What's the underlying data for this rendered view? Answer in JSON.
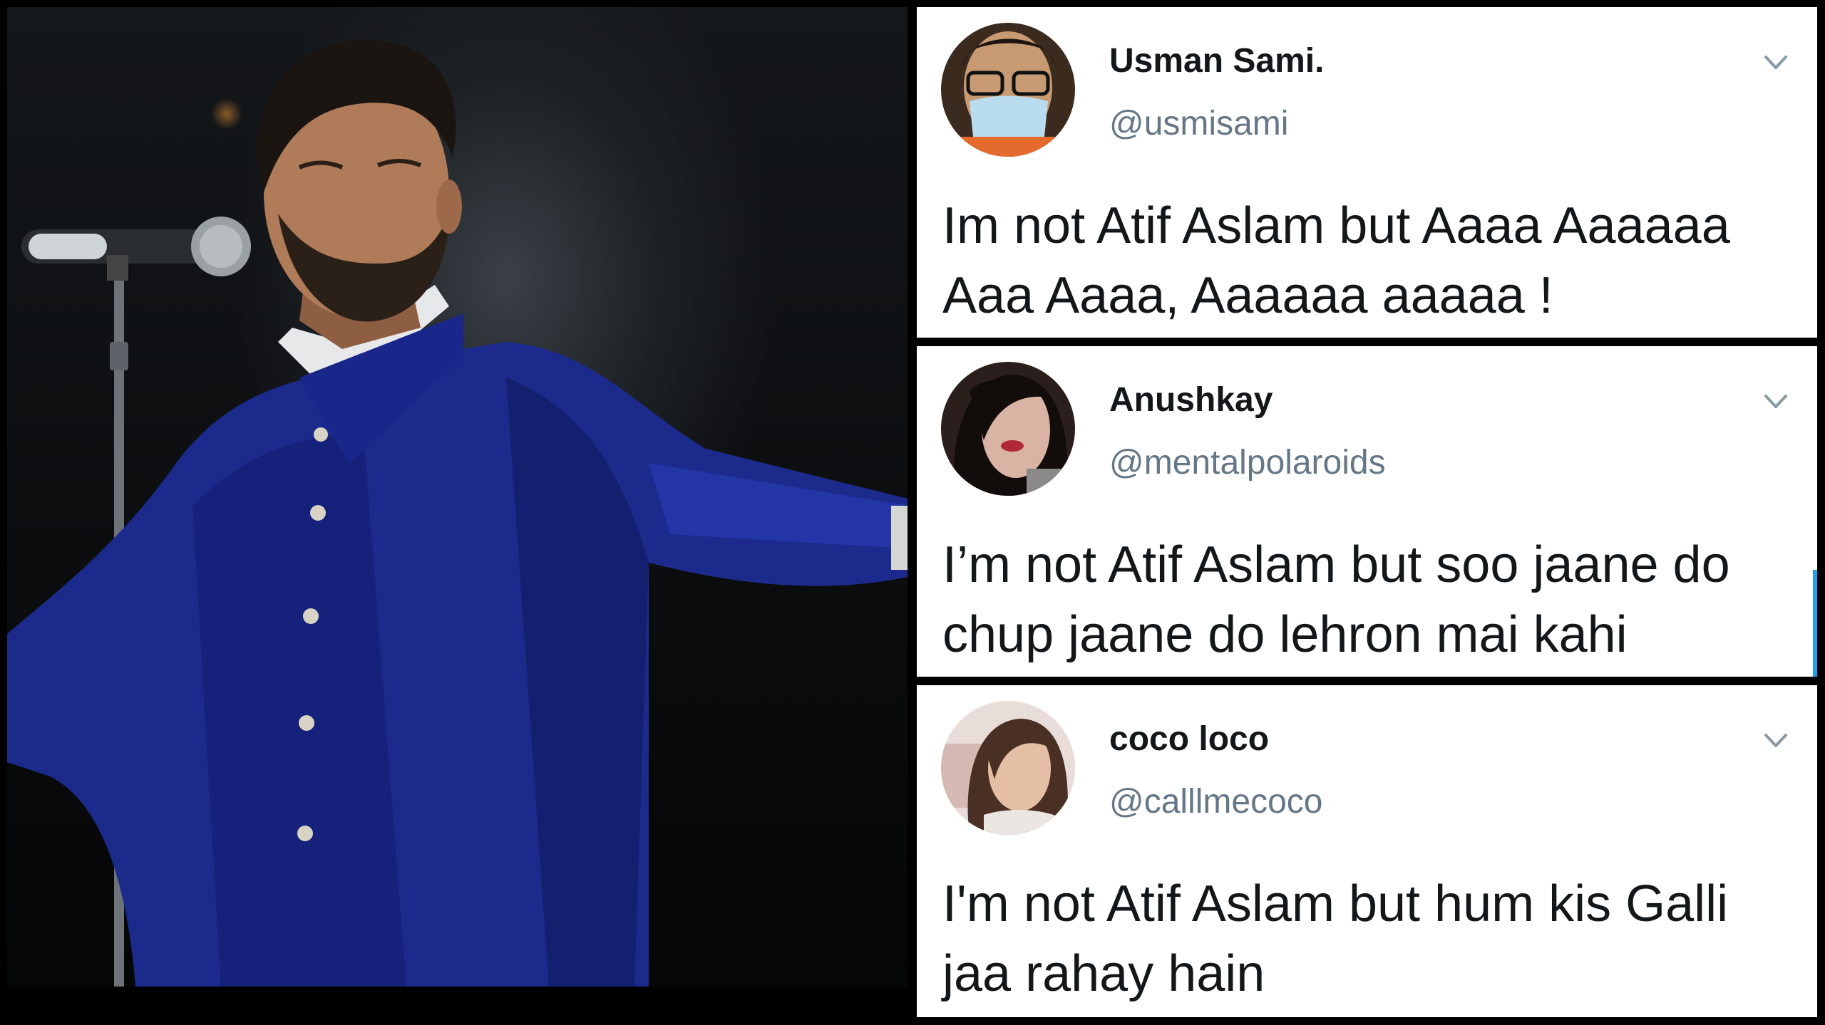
{
  "photo": {
    "subject": "singer-on-stage"
  },
  "tweets": [
    {
      "name": "Usman Sami.",
      "handle": "@usmisami",
      "text": "Im not Atif Aslam but Aaaa Aaaaaa Aaa Aaaa, Aaaaaa aaaaa !"
    },
    {
      "name": "Anushkay",
      "handle": "@mentalpolaroids",
      "text": "I’m not Atif Aslam but soo jaane do chup jaane do lehron mai kahi"
    },
    {
      "name": "coco loco",
      "handle": "@calllmecoco",
      "text": "I'm not Atif Aslam but hum kis Galli jaa rahay hain"
    }
  ],
  "icons": {
    "menu": "chevron-down-icon"
  },
  "colors": {
    "text": "#14171a",
    "handle": "#657786",
    "chevron": "#8899a6",
    "accent": "#1da1f2"
  }
}
